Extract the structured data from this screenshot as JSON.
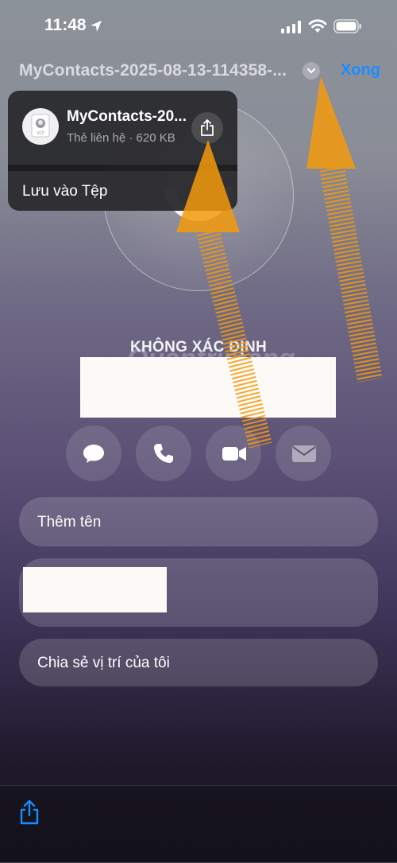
{
  "status": {
    "time": "11:48"
  },
  "nav": {
    "title": "MyContacts-2025-08-13-114358-...",
    "done_label": "Xong"
  },
  "contact": {
    "label": "KHÔNG XÁC ĐỊNH"
  },
  "watermark": "Quantrimang",
  "rows": {
    "add_name": "Thêm tên",
    "share_location": "Chia sẻ vị trí của tôi"
  },
  "menu": {
    "file_name": "MyContacts-20...",
    "file_meta": "Thẻ liên hệ · 620 KB",
    "file_ext": "VCF",
    "save_to_files": "Lưu vào Tệp"
  },
  "icons": {
    "location": "location-arrow-icon",
    "signal": "cellular-signal-icon",
    "wifi": "wifi-icon",
    "battery": "battery-icon",
    "chevron": "chevron-down-icon",
    "message": "message-icon",
    "phone": "phone-icon",
    "video": "video-icon",
    "mail": "mail-icon",
    "share": "share-icon",
    "file": "contact-card-file-icon"
  },
  "colors": {
    "accent": "#1a8cff",
    "annotation": "#f59a0c"
  }
}
